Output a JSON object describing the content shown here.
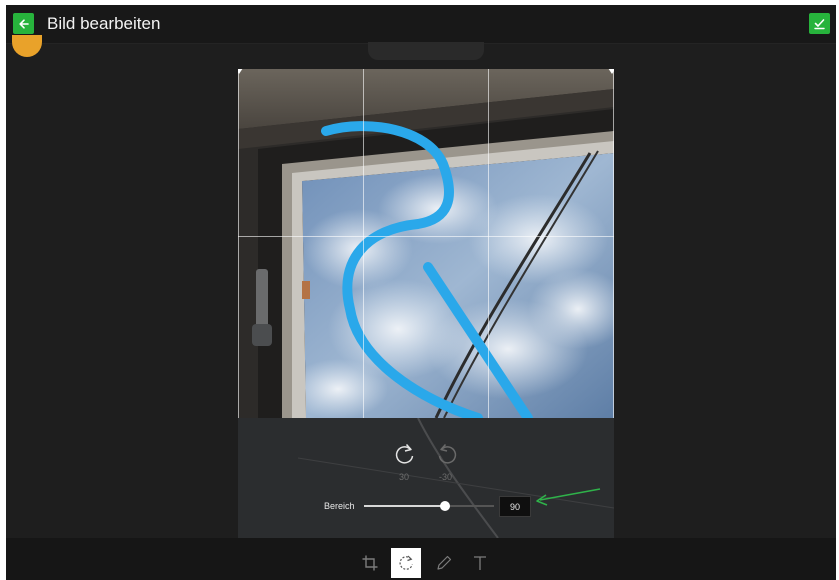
{
  "header": {
    "title": "Bild bearbeiten",
    "back_icon": "arrow-left-icon",
    "done_icon": "check-icon",
    "accent_color": "#27b33c"
  },
  "rotate": {
    "clockwise_label": "30",
    "counterclockwise_label": "-30",
    "range_label": "Bereich",
    "range_value": "90",
    "range_fraction": 0.62
  },
  "tools": [
    {
      "name": "crop",
      "icon": "crop-icon",
      "active": false
    },
    {
      "name": "rotate",
      "icon": "rotate-icon",
      "active": true
    },
    {
      "name": "draw",
      "icon": "pencil-icon",
      "active": false
    },
    {
      "name": "text",
      "icon": "text-icon",
      "active": false
    }
  ],
  "colors": {
    "drawing_stroke": "#2aa8ea",
    "annotation_arrow": "#2fb24a"
  }
}
